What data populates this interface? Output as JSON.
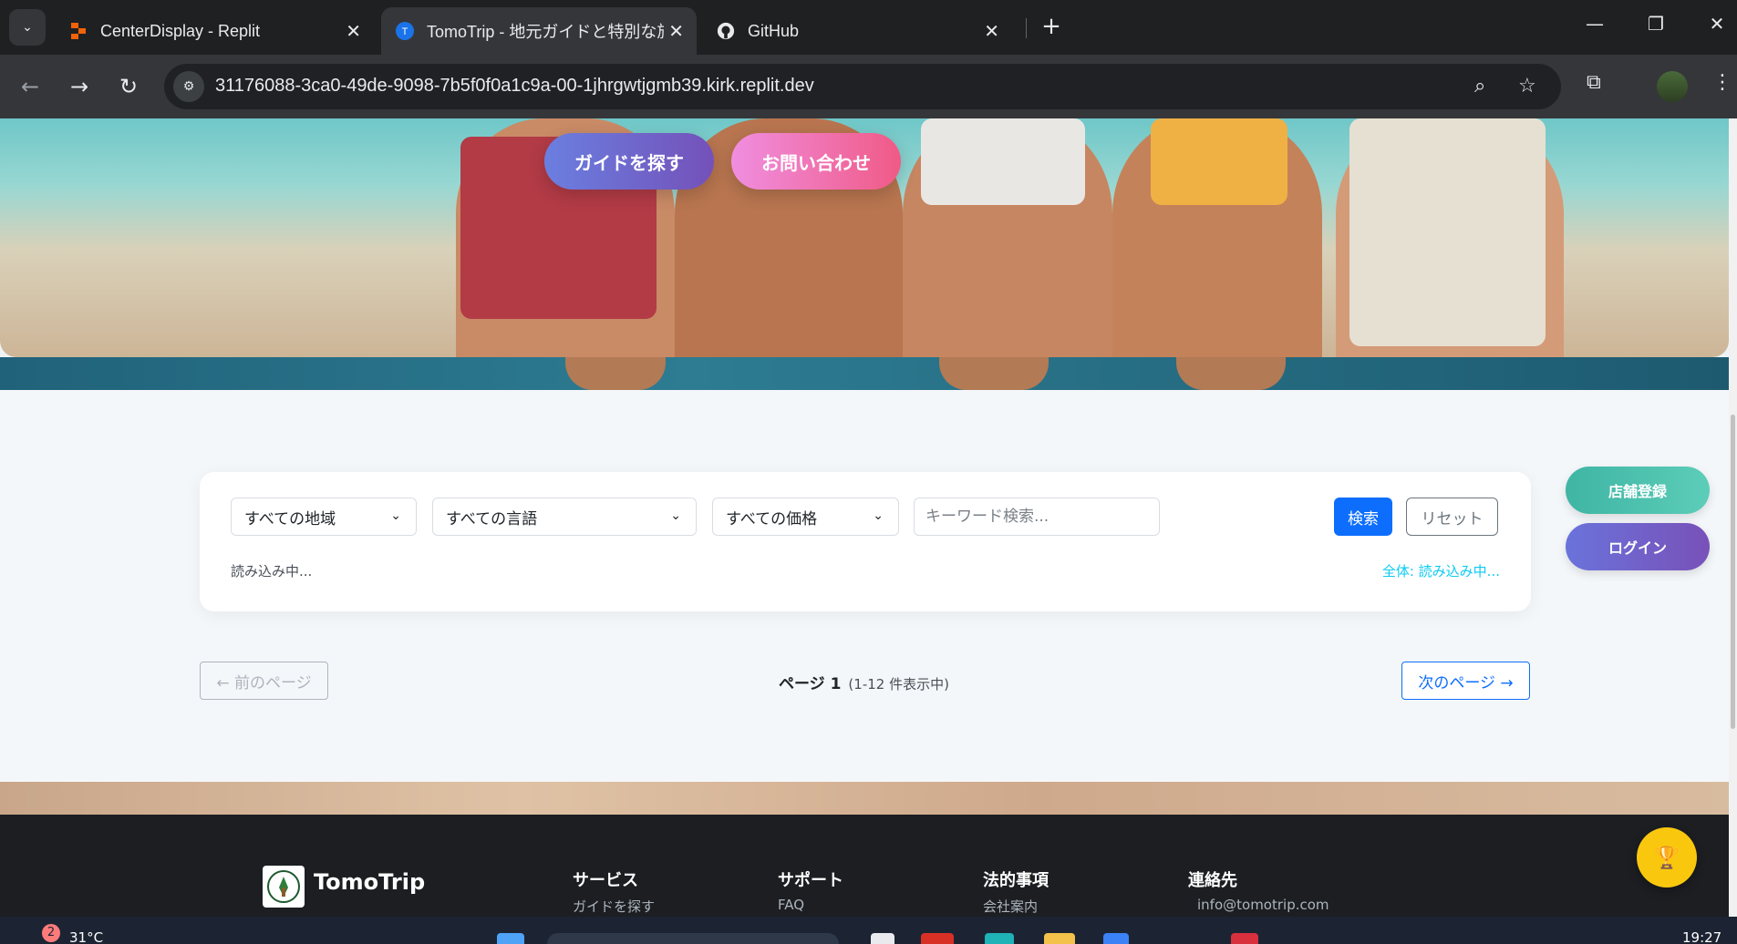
{
  "browser": {
    "tabs": [
      {
        "title": "CenterDisplay - Replit",
        "icon": "replit-icon",
        "active": false
      },
      {
        "title": "TomoTrip - 地元ガイドと特別な旅",
        "icon": "tomotrip-favicon",
        "active": true
      },
      {
        "title": "GitHub",
        "icon": "github-icon",
        "active": false
      }
    ],
    "url": "31176088-3ca0-49de-9098-7b5f0f0a1c9a-00-1jhrgwtjgmb39.kirk.replit.dev"
  },
  "hero": {
    "find_guide_label": "ガイドを探す",
    "contact_label": "お問い合わせ"
  },
  "filters": {
    "region": "すべての地域",
    "language": "すべての言語",
    "price": "すべての価格",
    "keyword_placeholder": "キーワード検索...",
    "search_label": "検索",
    "reset_label": "リセット",
    "status_left": "読み込み中...",
    "status_right": "全体: 読み込み中..."
  },
  "side_buttons": {
    "store_register": "店舗登録",
    "login": "ログイン"
  },
  "pagination": {
    "prev_label": "← 前のページ",
    "page_label": "ページ 1",
    "range_label": "(1-12 件表示中)",
    "next_label": "次のページ →"
  },
  "footer": {
    "brand": "TomoTrip",
    "columns": [
      {
        "title": "サービス",
        "first_item": "ガイドを探す"
      },
      {
        "title": "サポート",
        "first_item": "FAQ"
      },
      {
        "title": "法的事項",
        "first_item": "会社案内"
      },
      {
        "title": "連絡先",
        "first_item": "info@tomotrip.com"
      }
    ]
  },
  "taskbar": {
    "temperature": "31°C",
    "notifications": "2",
    "time": "19:27"
  },
  "colors": {
    "primary": "#0d6efd",
    "accent_cyan": "#0dcaf0",
    "hero_purple": "#7451b9",
    "hero_pink": "#f05a86",
    "store_teal": "#3fb5a4",
    "footer_bg": "#1c1e22"
  }
}
